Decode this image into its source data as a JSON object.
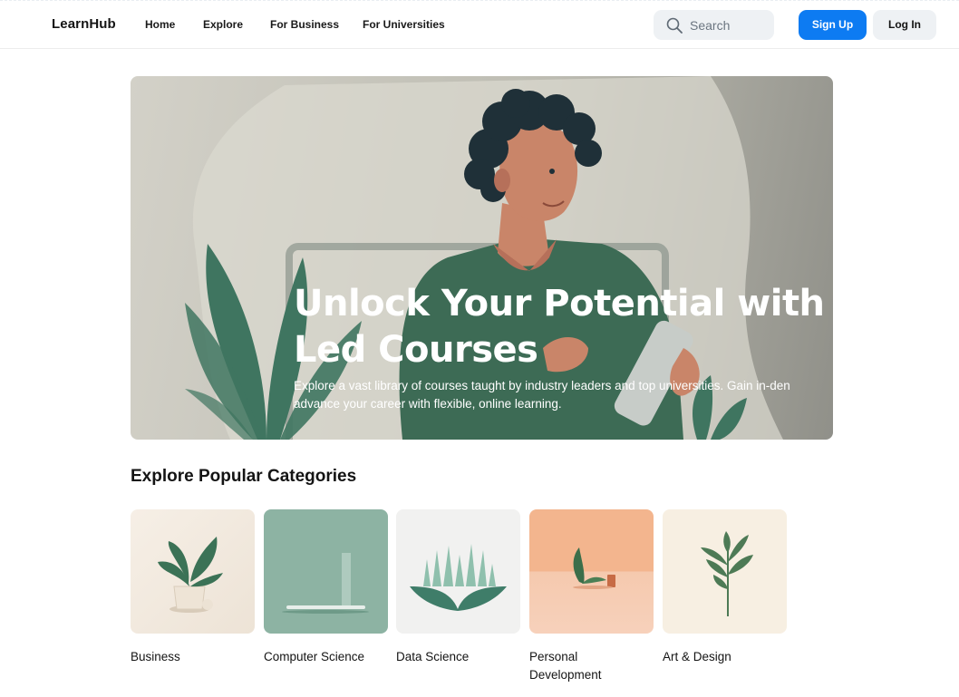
{
  "header": {
    "logo": "LearnHub",
    "nav": [
      {
        "label": "Home"
      },
      {
        "label": "Explore"
      },
      {
        "label": "For Business"
      },
      {
        "label": "For Universities"
      }
    ],
    "search_placeholder": "Search",
    "signup_label": "Sign Up",
    "login_label": "Log In",
    "accent_color": "#0d7bf2"
  },
  "hero": {
    "title_line1": "Unlock Your Potential with Exp",
    "title_line2": "Led Courses",
    "subtitle_line1": "Explore a vast library of courses taught by industry leaders and top universities. Gain in-den",
    "subtitle_line2": "advance your career with flexible, online learning."
  },
  "categories": {
    "title": "Explore Popular Categories",
    "items": [
      {
        "name": "Business",
        "image": "potted-plant"
      },
      {
        "name": "Computer Science",
        "image": "laptop"
      },
      {
        "name": "Data Science",
        "image": "data-plant"
      },
      {
        "name": "Personal Development",
        "name_line1": "Personal",
        "name_line2": "Development",
        "image": "sprout"
      },
      {
        "name": "Art & Design",
        "image": "leaf-sprig"
      }
    ]
  }
}
